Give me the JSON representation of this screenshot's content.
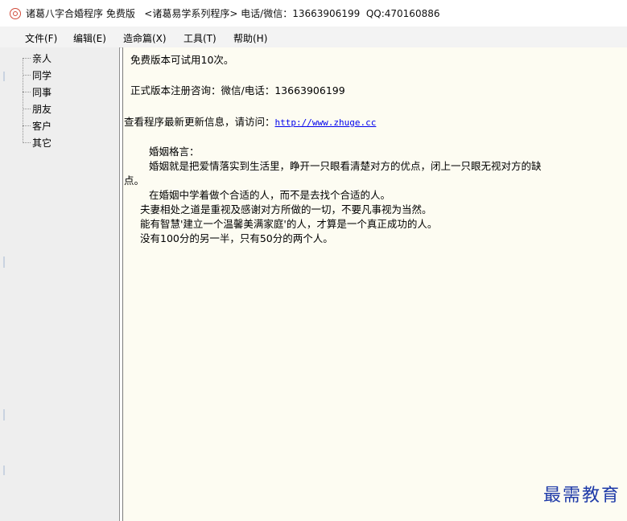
{
  "window": {
    "title": "诸葛八字合婚程序 免费版   <诸葛易学系列程序> 电话/微信：13663906199  QQ:470160886"
  },
  "menu": {
    "items": [
      {
        "label": "文件(F)"
      },
      {
        "label": "编辑(E)"
      },
      {
        "label": "造命篇(X)"
      },
      {
        "label": "工具(T)"
      },
      {
        "label": "帮助(H)"
      }
    ]
  },
  "sidebar": {
    "items": [
      {
        "label": "亲人"
      },
      {
        "label": "同学"
      },
      {
        "label": "同事"
      },
      {
        "label": "朋友"
      },
      {
        "label": "客户"
      },
      {
        "label": "其它"
      }
    ]
  },
  "content": {
    "trial": "免费版本可试用10次。",
    "register": "正式版本注册咨询：微信/电话：13663906199",
    "visit_prefix": "查看程序最新更新信息，请访问：",
    "visit_link": "http://www.zhuge.cc",
    "quote_title": "婚姻格言：",
    "quote_1a": "婚姻就是把爱情落实到生活里，睁开一只眼看清楚对方的优点，闭上一只眼无视对方的缺",
    "quote_1b": "点。",
    "quote_2": "在婚姻中学着做个合适的人，而不是去找个合适的人。",
    "quote_3": "夫妻相处之道是重视及感谢对方所做的一切，不要凡事视为当然。",
    "quote_4": "能有智慧'建立一个温馨美满家庭'的人，才算是一个真正成功的人。",
    "quote_5": "没有100分的另一半，只有50分的两个人。"
  },
  "watermark": "最需教育"
}
